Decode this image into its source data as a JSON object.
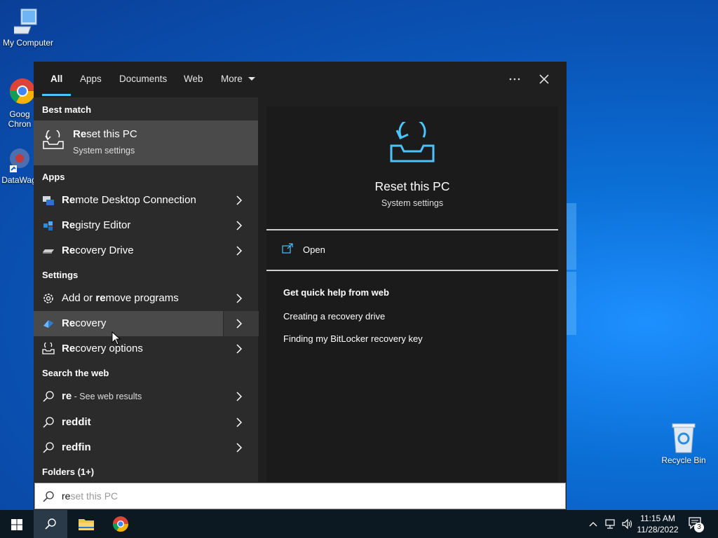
{
  "desktop": {
    "icons": [
      {
        "label": "My Computer",
        "icon": "computer-icon"
      },
      {
        "label": "Goog Chron",
        "icon": "chrome-icon"
      },
      {
        "label": "DataWag",
        "icon": "datawag-icon"
      },
      {
        "label": "Recycle Bin",
        "icon": "recycle-bin-icon"
      }
    ]
  },
  "start": {
    "tabs": [
      "All",
      "Apps",
      "Documents",
      "Web",
      "More"
    ],
    "active_tab": "All",
    "best_match_heading": "Best match",
    "best_match": {
      "title_bold": "Re",
      "title_rest": "set this PC",
      "subtitle": "System settings",
      "icon": "reset-icon"
    },
    "apps_heading": "Apps",
    "apps": [
      {
        "bold": "Re",
        "rest": "mote Desktop Connection",
        "icon": "remote-desktop-icon"
      },
      {
        "bold": "Re",
        "rest": "gistry Editor",
        "icon": "registry-editor-icon"
      },
      {
        "bold": "Re",
        "rest": "covery Drive",
        "icon": "recovery-drive-icon"
      }
    ],
    "settings_heading": "Settings",
    "settings": [
      {
        "pre": "Add or ",
        "bold": "re",
        "rest": "move programs",
        "icon": "gear-icon"
      },
      {
        "pre": "",
        "bold": "Re",
        "rest": "covery",
        "icon": "recovery-icon"
      },
      {
        "pre": "",
        "bold": "Re",
        "rest": "covery options",
        "icon": "recovery-options-icon"
      }
    ],
    "web_heading": "Search the web",
    "web": [
      {
        "bold": "re",
        "sub": " - See web results"
      },
      {
        "bold": "reddit",
        "sub": ""
      },
      {
        "bold": "redfin",
        "sub": ""
      }
    ],
    "folders_heading": "Folders (1+)",
    "preview": {
      "title": "Reset this PC",
      "subtitle": "System settings",
      "open_label": "Open",
      "help_heading": "Get quick help from web",
      "links": [
        "Creating a recovery drive",
        "Finding my BitLocker recovery key"
      ]
    },
    "search": {
      "typed": "re",
      "completion": "set this PC"
    }
  },
  "taskbar": {
    "time": "11:15 AM",
    "date": "11/28/2022",
    "notification_count": "3"
  },
  "colors": {
    "accent": "#4cc2ff",
    "panel": "#1f1f1f",
    "left_pane": "#2b2b2b",
    "highlight": "#4a4a4a"
  }
}
